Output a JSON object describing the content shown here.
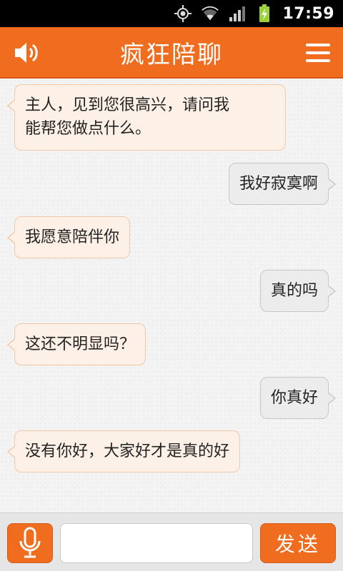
{
  "status_bar": {
    "time": "17:59",
    "icons": [
      "gps-icon",
      "wifi-icon",
      "signal-icon",
      "battery-charging-icon"
    ]
  },
  "header": {
    "title": "疯狂陪聊",
    "left_icon": "speaker-icon",
    "right_icon": "menu-icon",
    "accent_color": "#f06d1f"
  },
  "messages": [
    {
      "side": "left",
      "text_lines": [
        "主人，见到您很高兴，请问我",
        "能帮您做点什么。"
      ]
    },
    {
      "side": "right",
      "text": "我好寂寞啊"
    },
    {
      "side": "left",
      "text": "我愿意陪伴你"
    },
    {
      "side": "right",
      "text": "真的吗"
    },
    {
      "side": "left",
      "text": "这还不明显吗？"
    },
    {
      "side": "right",
      "text": "你真好"
    },
    {
      "side": "left",
      "text": "没有你好，大家好才是真的好"
    }
  ],
  "input_bar": {
    "mic_icon": "microphone-icon",
    "input_value": "",
    "send_label": "发送"
  }
}
